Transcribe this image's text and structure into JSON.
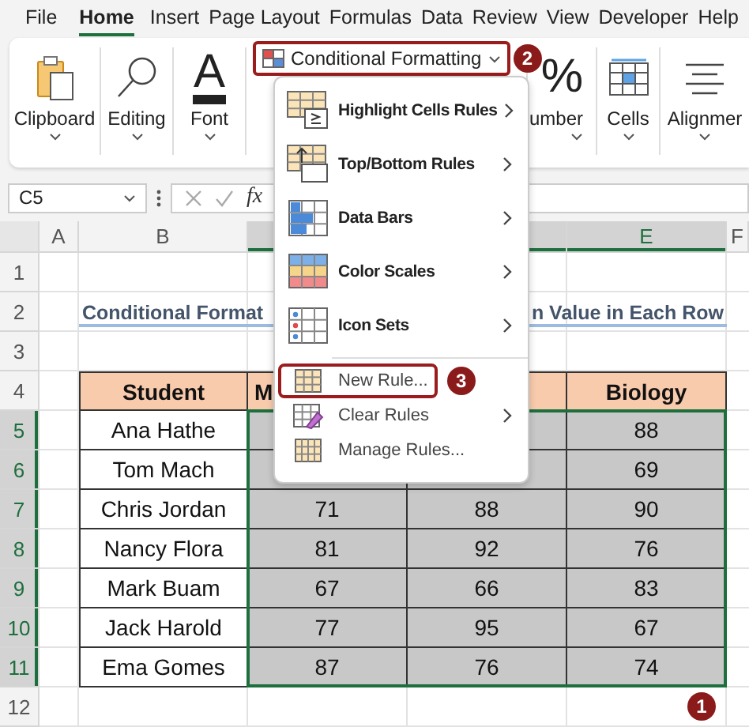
{
  "tabs": [
    {
      "label": "File",
      "selected": false
    },
    {
      "label": "Home",
      "selected": true
    },
    {
      "label": "Insert",
      "selected": false
    },
    {
      "label": "Page Layout",
      "selected": false
    },
    {
      "label": "Formulas",
      "selected": false
    },
    {
      "label": "Data",
      "selected": false
    },
    {
      "label": "Review",
      "selected": false
    },
    {
      "label": "View",
      "selected": false
    },
    {
      "label": "Developer",
      "selected": false
    },
    {
      "label": "Help",
      "selected": false
    }
  ],
  "ribbon": {
    "groups_left": [
      {
        "label": "Clipboard",
        "kind": "drawn"
      },
      {
        "label": "Editing",
        "kind": "drawn"
      },
      {
        "label": "Font",
        "kind": "glyph",
        "glyph": "A"
      }
    ],
    "cf_button": {
      "label": "Conditional Formatting",
      "annotated": true,
      "badge": "2"
    },
    "groups_right": [
      {
        "label": "umber",
        "kind": "glyph",
        "glyph": "%"
      },
      {
        "label": "Cells",
        "kind": "drawn"
      },
      {
        "label": "Alignmer",
        "kind": "drawn"
      }
    ]
  },
  "formula_bar": {
    "name_box": "C5",
    "fx": "fx"
  },
  "sheet": {
    "column_headers": [
      {
        "label": "A",
        "selected": false
      },
      {
        "label": "B",
        "selected": false
      },
      {
        "selected": true
      },
      {
        "selected": true
      },
      {
        "label": "E",
        "selected": true
      },
      {
        "label": "F",
        "selected": false
      }
    ],
    "row_headers": [
      {
        "label": "1",
        "selected": false
      },
      {
        "label": "2",
        "selected": false
      },
      {
        "label": "3",
        "selected": false
      },
      {
        "label": "4",
        "selected": false
      },
      {
        "label": "5",
        "selected": true
      },
      {
        "label": "6",
        "selected": true
      },
      {
        "label": "7",
        "selected": true
      },
      {
        "label": "8",
        "selected": true
      },
      {
        "label": "9",
        "selected": true
      },
      {
        "label": "10",
        "selected": true
      },
      {
        "label": "11",
        "selected": true
      },
      {
        "label": "12",
        "selected": false
      }
    ],
    "title_left": "Conditional Format",
    "title_right": "n Value in Each Row",
    "table": {
      "header": {
        "student": "Student",
        "column_2": "M",
        "biology": "Biology"
      },
      "rows": [
        {
          "student": "Ana Hathe",
          "biology": "88",
          "selected": true
        },
        {
          "student": "Tom Mach",
          "biology": "69",
          "selected": true
        },
        {
          "student": "Chris Jordan",
          "column_2": "71",
          "column_3": "88",
          "biology": "90",
          "selected": true
        },
        {
          "student": "Nancy Flora",
          "column_2": "81",
          "column_3": "92",
          "biology": "76",
          "selected": true
        },
        {
          "student": "Mark Buam",
          "column_2": "67",
          "column_3": "66",
          "biology": "83",
          "selected": true
        },
        {
          "student": "Jack Harold",
          "column_2": "77",
          "column_3": "95",
          "biology": "67",
          "selected": true
        },
        {
          "student": "Ema Gomes",
          "column_2": "87",
          "column_3": "76",
          "biology": "74",
          "selected": true
        }
      ]
    },
    "selection_badge": "1"
  },
  "menu": {
    "items": [
      {
        "label": "Highlight Cells Rules",
        "kind": "large",
        "submenu": true,
        "annotated": false
      },
      {
        "label": "Top/Bottom Rules",
        "kind": "large",
        "submenu": true,
        "annotated": false
      },
      {
        "label": "Data Bars",
        "kind": "large",
        "submenu": true,
        "annotated": false
      },
      {
        "label": "Color Scales",
        "kind": "large",
        "submenu": true,
        "annotated": false
      },
      {
        "label": "Icon Sets",
        "kind": "large",
        "submenu": true,
        "annotated": false
      },
      {
        "label": "New Rule...",
        "kind": "small",
        "submenu": false,
        "annotated": true,
        "badge": "3"
      },
      {
        "label": "Clear Rules",
        "kind": "small",
        "submenu": true,
        "annotated": false
      },
      {
        "label": "Manage Rules...",
        "kind": "small",
        "submenu": false,
        "annotated": false
      }
    ]
  }
}
